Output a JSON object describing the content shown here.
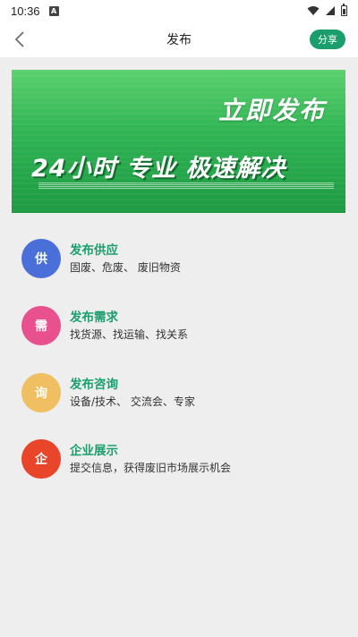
{
  "status_bar": {
    "time": "10:36",
    "notification_letter": "A"
  },
  "header": {
    "title": "发布",
    "share_label": "分享"
  },
  "banner": {
    "title": "立即发布",
    "subtitle": "24小时 专业 极速解决"
  },
  "items": [
    {
      "badge": "供",
      "title": "发布供应",
      "subtitle": "固废、危废、 废旧物资",
      "color": "#4a6fd8"
    },
    {
      "badge": "需",
      "title": "发布需求",
      "subtitle": "找货源、找运输、找关系",
      "color": "#e8508e"
    },
    {
      "badge": "询",
      "title": "发布咨询",
      "subtitle": "设备/技术、 交流会、专家",
      "color": "#f0bf62"
    },
    {
      "badge": "企",
      "title": "企业展示",
      "subtitle": "提交信息，获得废旧市场展示机会",
      "color": "#e8452a"
    }
  ],
  "colors": {
    "accent": "#1a9e6e"
  }
}
